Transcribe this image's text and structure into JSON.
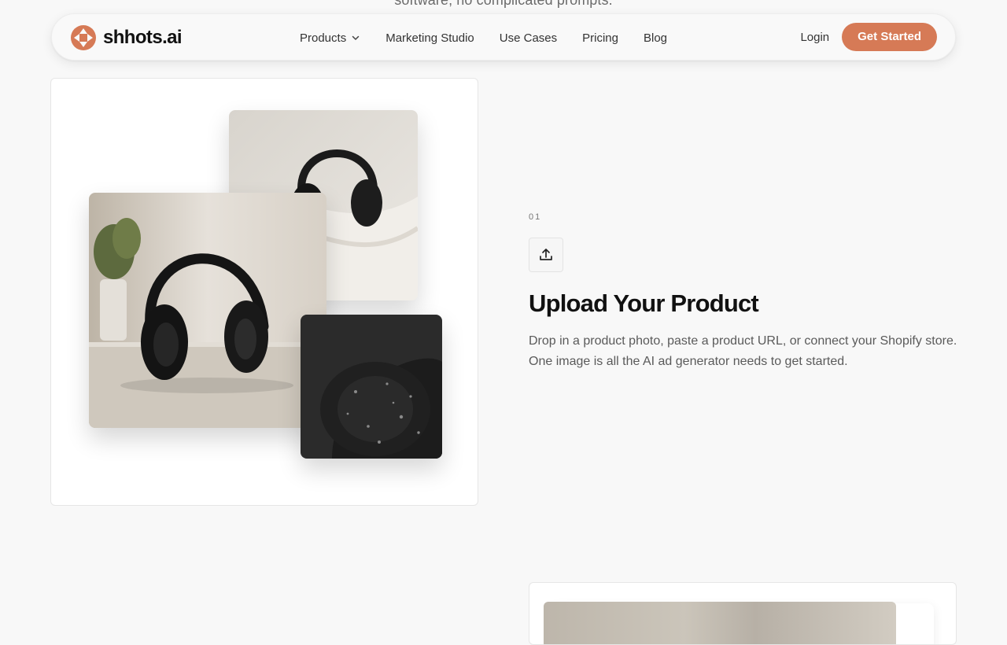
{
  "hero": {
    "tagline_fragment": "software, no complicated prompts."
  },
  "nav": {
    "brand": "shhots.ai",
    "links": [
      {
        "label": "Products",
        "has_dropdown": true
      },
      {
        "label": "Marketing Studio"
      },
      {
        "label": "Use Cases"
      },
      {
        "label": "Pricing"
      },
      {
        "label": "Blog"
      }
    ],
    "login_label": "Login",
    "cta_label": "Get Started"
  },
  "step": {
    "number": "01",
    "icon": "upload-icon",
    "title": "Upload Your Product",
    "description": "Drop in a product photo, paste a product URL, or connect your Shopify store. One image is all the AI ad generator needs to get started."
  },
  "colors": {
    "accent": "#d67a56",
    "background": "#f8f8f8",
    "text_primary": "#111111",
    "text_secondary": "#5a5a5a"
  }
}
